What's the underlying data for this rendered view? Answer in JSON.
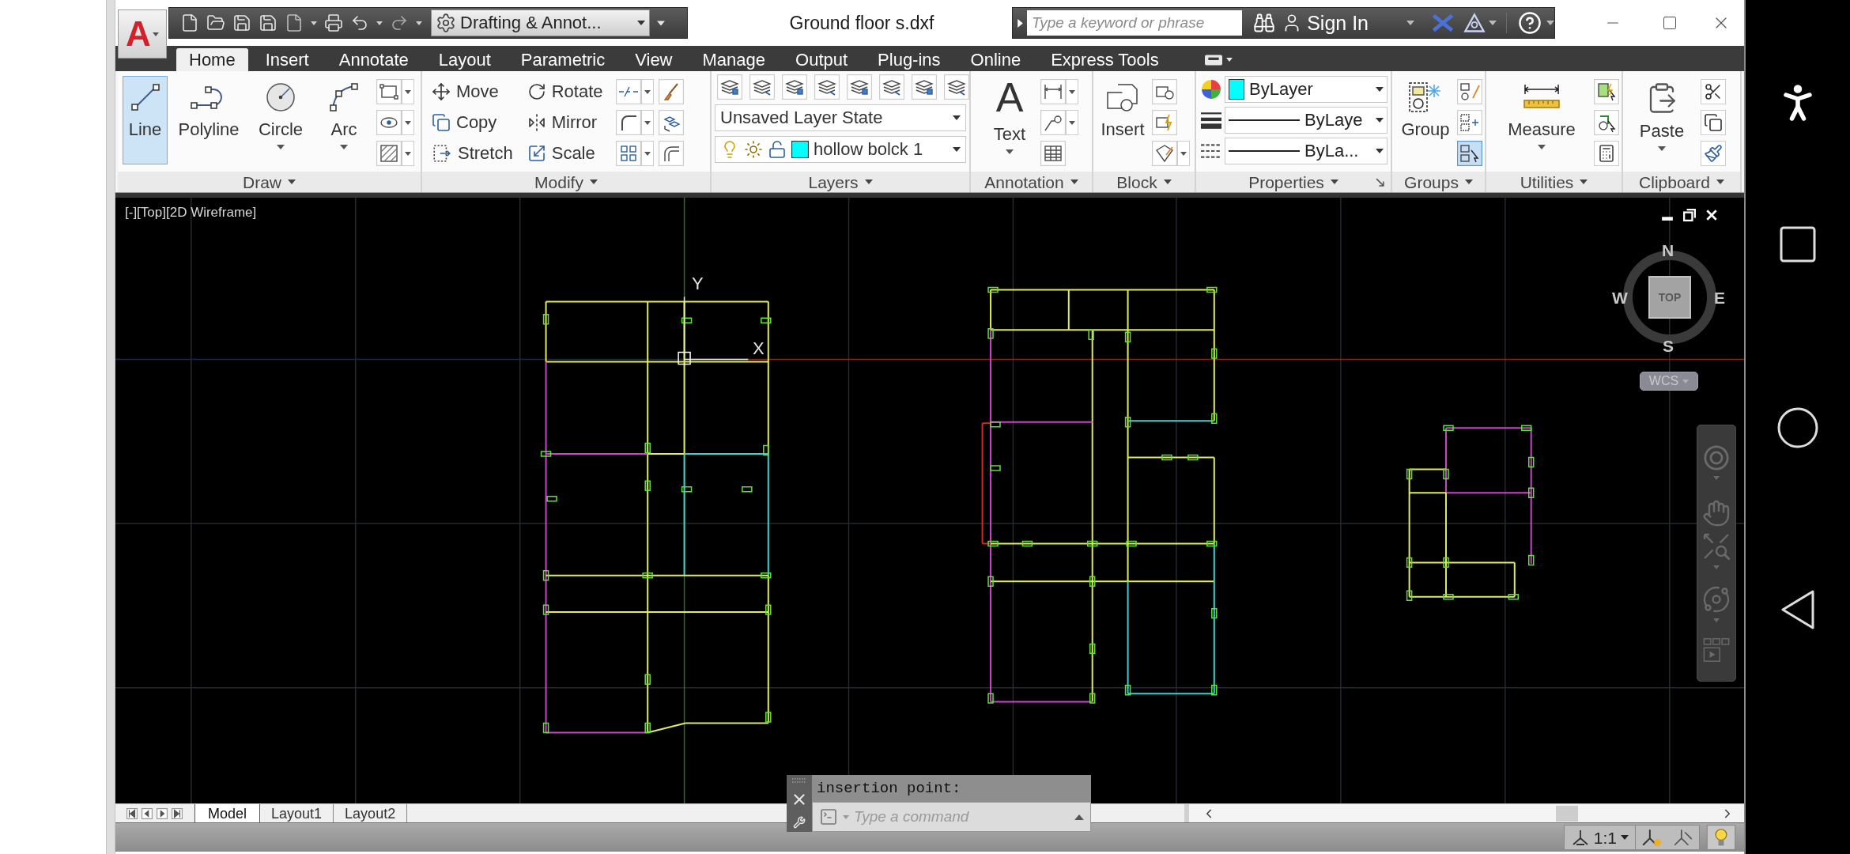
{
  "app_button": {
    "glyph": "A"
  },
  "quick_access": {
    "workspace": "Drafting & Annot..."
  },
  "window": {
    "title": "Ground floor s.dxf"
  },
  "search": {
    "placeholder": "Type a keyword or phrase"
  },
  "account": {
    "sign_in": "Sign In"
  },
  "tabs": [
    {
      "label": "Home",
      "selected": true
    },
    {
      "label": "Insert",
      "selected": false
    },
    {
      "label": "Annotate",
      "selected": false
    },
    {
      "label": "Layout",
      "selected": false
    },
    {
      "label": "Parametric",
      "selected": false
    },
    {
      "label": "View",
      "selected": false
    },
    {
      "label": "Manage",
      "selected": false
    },
    {
      "label": "Output",
      "selected": false
    },
    {
      "label": "Plug-ins",
      "selected": false
    },
    {
      "label": "Online",
      "selected": false
    },
    {
      "label": "Express Tools",
      "selected": false
    }
  ],
  "ribbon": {
    "draw": {
      "title": "Draw",
      "tools": [
        {
          "label": "Line",
          "selected": true
        },
        {
          "label": "Polyline",
          "selected": false
        },
        {
          "label": "Circle",
          "selected": false
        },
        {
          "label": "Arc",
          "selected": false
        }
      ]
    },
    "modify": {
      "title": "Modify",
      "tools": [
        "Move",
        "Copy",
        "Stretch",
        "Rotate",
        "Mirror",
        "Scale"
      ]
    },
    "layers": {
      "title": "Layers",
      "layer_state": "Unsaved Layer State",
      "current_layer": "hollow bolck 1"
    },
    "annotation": {
      "title": "Annotation",
      "glyph": "A",
      "tool": "Text"
    },
    "block": {
      "title": "Block",
      "tool": "Insert"
    },
    "properties": {
      "title": "Properties",
      "color_setting": "ByLayer",
      "lineweight": "ByLaye",
      "linetype": "ByLa..."
    },
    "groups": {
      "title": "Groups",
      "tool": "Group",
      "selection_on": true
    },
    "utilities": {
      "title": "Utilities",
      "tool": "Measure"
    },
    "clipboard": {
      "title": "Clipboard",
      "tool": "Paste"
    }
  },
  "viewport": {
    "label": "[-][Top][2D Wireframe]",
    "ucs": {
      "x": "X",
      "y": "Y"
    }
  },
  "viewcube": {
    "north": "N",
    "west": "W",
    "east": "E",
    "south": "S",
    "face": "TOP",
    "ucs_menu": "WCS"
  },
  "command_line": {
    "history": "insertion point:",
    "placeholder": "Type a command"
  },
  "layout_tabs": [
    {
      "label": "Model",
      "selected": true
    },
    {
      "label": "Layout1",
      "selected": false
    },
    {
      "label": "Layout2",
      "selected": false
    }
  ],
  "status_bar": {
    "annotation_scale": "1:1"
  }
}
